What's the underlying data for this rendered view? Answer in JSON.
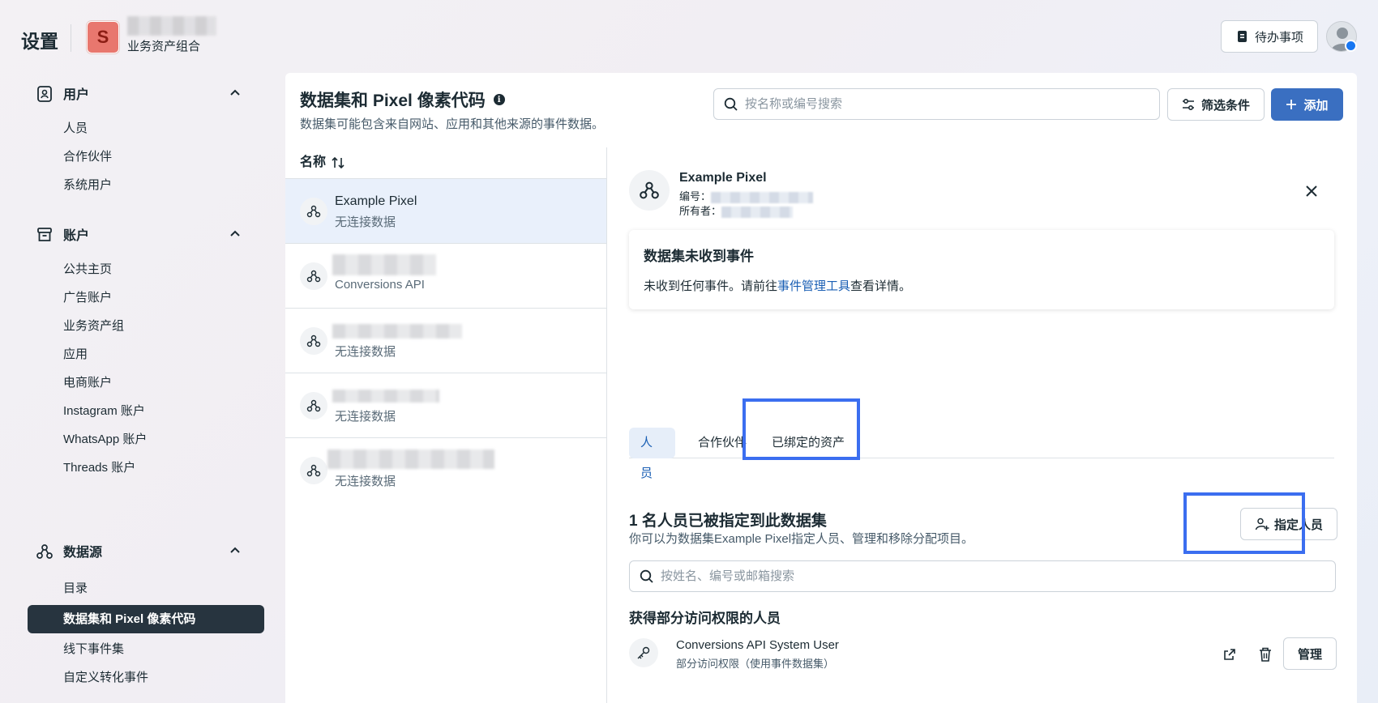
{
  "app": {
    "title": "设置",
    "business_initial": "S",
    "business_subtitle": "业务资产组合",
    "todo_label": "待办事项"
  },
  "sidebar": {
    "sections": [
      {
        "label": "用户",
        "icon": "user-badge-icon",
        "items": [
          "人员",
          "合作伙伴",
          "系统用户"
        ]
      },
      {
        "label": "账户",
        "icon": "archive-box-icon",
        "items": [
          "公共主页",
          "广告账户",
          "业务资产组",
          "应用",
          "电商账户",
          "Instagram 账户",
          "WhatsApp 账户",
          "Threads 账户"
        ]
      },
      {
        "label": "数据源",
        "icon": "data-source-icon",
        "items": [
          "目录",
          "数据集和 Pixel 像素代码",
          "线下事件集",
          "自定义转化事件"
        ]
      }
    ],
    "active_item": "数据集和 Pixel 像素代码"
  },
  "panel": {
    "title": "数据集和 Pixel 像素代码",
    "subtitle": "数据集可能包含来自网站、应用和其他来源的事件数据。",
    "search_placeholder": "按名称或编号搜索",
    "filter_label": "筛选条件",
    "add_label": "添加"
  },
  "list": {
    "header": "名称",
    "rows": [
      {
        "name": "Example Pixel",
        "sub": "无连接数据",
        "selected": true
      },
      {
        "name": "",
        "sub": "Conversions API",
        "selected": false
      },
      {
        "name": "",
        "sub": "无连接数据",
        "selected": false
      },
      {
        "name": "",
        "sub": "无连接数据",
        "selected": false
      },
      {
        "name": "",
        "sub": "无连接数据",
        "selected": false
      }
    ]
  },
  "detail": {
    "name": "Example Pixel",
    "id_label": "编号：",
    "owner_label": "所有者：",
    "notice_title": "数据集未收到事件",
    "notice_text_before": "未收到任何事件。请前往",
    "notice_link": "事件管理工具",
    "notice_text_after": "查看详情。",
    "tabs": [
      "人员",
      "合作伙伴",
      "已绑定的资产"
    ],
    "active_tab": "人员",
    "people_title": "1 名人员已被指定到此数据集",
    "people_subtitle": "你可以为数据集Example Pixel指定人员、管理和移除分配项目。",
    "assign_label": "指定人员",
    "people_search_placeholder": "按姓名、编号或邮箱搜索",
    "partial_title": "获得部分访问权限的人员",
    "user": {
      "name": "Conversions API System User",
      "access": "部分访问权限（使用事件数据集）",
      "manage_label": "管理"
    }
  },
  "colors": {
    "accent": "#3a6fc1",
    "highlight": "#3b6ef0",
    "active_nav": "#27343f",
    "link": "#1a5fb4"
  }
}
